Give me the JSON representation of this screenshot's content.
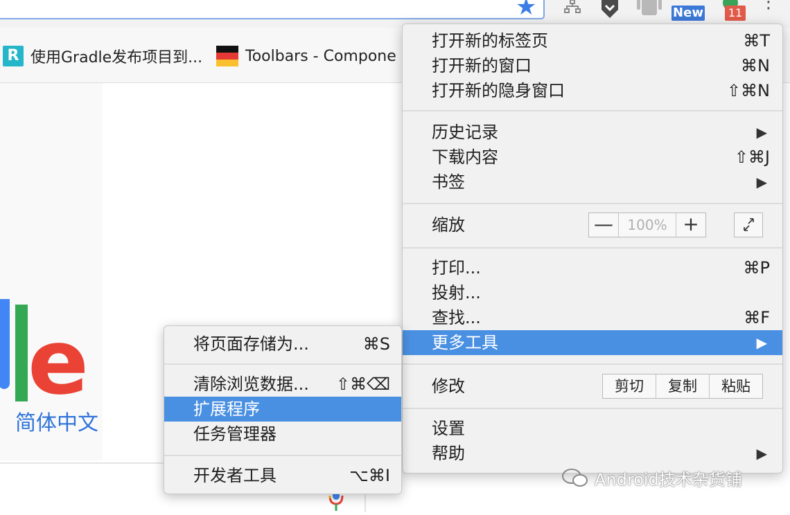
{
  "toolbar": {
    "new_badge": "New",
    "notification_count": "11",
    "icons": [
      "bookmark-star-icon",
      "network-icon",
      "download-shield-icon",
      "android-icon",
      "new-extension-icon",
      "notification-extension-icon",
      "menu-kebab-icon"
    ]
  },
  "bookmarks": {
    "items": [
      {
        "label": "使用Gradle发布项目到...",
        "icon": "r-favicon"
      },
      {
        "label": "Toolbars - Compone",
        "icon": "flag-favicon"
      }
    ]
  },
  "page": {
    "logo_text": "e",
    "language_link": "简体中文",
    "logo_colors": {
      "blue": "#4285f4",
      "green": "#34a853",
      "red": "#ea4335"
    }
  },
  "menu": {
    "new_tab": {
      "label": "打开新的标签页",
      "shortcut": "⌘T"
    },
    "new_window": {
      "label": "打开新的窗口",
      "shortcut": "⌘N"
    },
    "new_incognito": {
      "label": "打开新的隐身窗口",
      "shortcut": "⇧⌘N"
    },
    "history": {
      "label": "历史记录"
    },
    "downloads": {
      "label": "下载内容",
      "shortcut": "⇧⌘J"
    },
    "bookmarks": {
      "label": "书签"
    },
    "zoom": {
      "label": "缩放",
      "minus": "—",
      "value": "100%",
      "plus": "+"
    },
    "print": {
      "label": "打印...",
      "shortcut": "⌘P"
    },
    "cast": {
      "label": "投射..."
    },
    "find": {
      "label": "查找...",
      "shortcut": "⌘F"
    },
    "more_tools": {
      "label": "更多工具"
    },
    "edit": {
      "label": "修改",
      "cut": "剪切",
      "copy": "复制",
      "paste": "粘贴"
    },
    "settings": {
      "label": "设置"
    },
    "help": {
      "label": "帮助"
    },
    "arrow": "▶"
  },
  "submenu": {
    "save_page": {
      "label": "将页面存储为...",
      "shortcut": "⌘S"
    },
    "clear_data": {
      "label": "清除浏览数据...",
      "shortcut": "⇧⌘⌫"
    },
    "extensions": {
      "label": "扩展程序"
    },
    "task_manager": {
      "label": "任务管理器"
    },
    "dev_tools": {
      "label": "开发者工具",
      "shortcut": "⌥⌘I"
    }
  },
  "watermark": {
    "text": "Android技术杂货铺"
  },
  "colors": {
    "highlight": "#4a90e2",
    "menu_bg": "#f1f1f1"
  }
}
